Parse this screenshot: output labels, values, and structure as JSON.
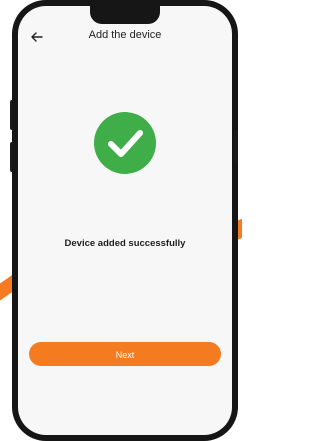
{
  "header": {
    "title": "Add the device",
    "back_icon": "arrow-left-icon"
  },
  "status": {
    "icon": "check-circle-icon",
    "icon_color": "#3fae49",
    "message": "Device added successfully"
  },
  "footer": {
    "next_label": "Next",
    "accent_color": "#f47b20"
  }
}
